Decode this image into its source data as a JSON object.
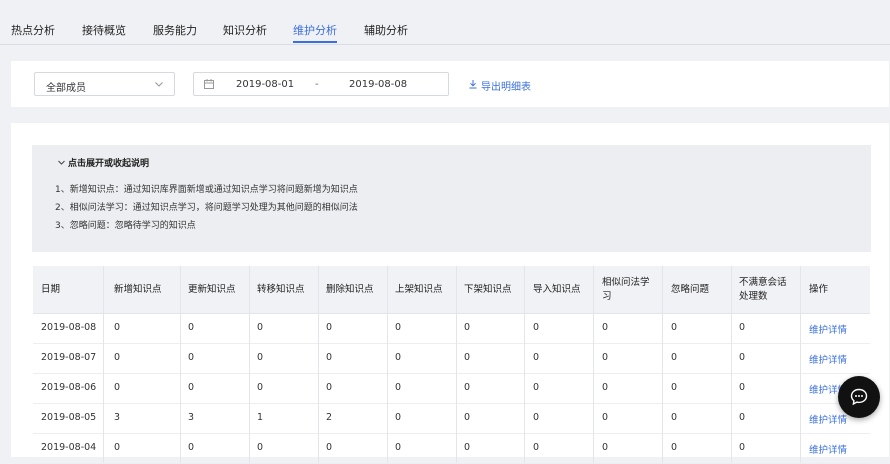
{
  "tabs": [
    {
      "label": "热点分析",
      "active": false
    },
    {
      "label": "接待概览",
      "active": false
    },
    {
      "label": "服务能力",
      "active": false
    },
    {
      "label": "知识分析",
      "active": false
    },
    {
      "label": "维护分析",
      "active": true
    },
    {
      "label": "辅助分析",
      "active": false
    }
  ],
  "filters": {
    "member_select": "全部成员",
    "date_start": "2019-08-01",
    "date_separator": "-",
    "date_end": "2019-08-08",
    "export_label": "导出明细表"
  },
  "explanation": {
    "toggle_label": "点击展开或收起说明",
    "lines": [
      "1、新增知识点：通过知识库界面新增或通过知识点学习将问题新增为知识点",
      "2、相似问法学习：通过知识点学习，将问题学习处理为其他问题的相似问法",
      "3、忽略问题：忽略待学习的知识点"
    ]
  },
  "table": {
    "headers": [
      "日期",
      "新增知识点",
      "更新知识点",
      "转移知识点",
      "删除知识点",
      "上架知识点",
      "下架知识点",
      "导入知识点",
      "相似问法学习",
      "忽略问题",
      "不满意会话处理数",
      "操作"
    ],
    "header_lines": [
      [
        "日期"
      ],
      [
        "新增知识点"
      ],
      [
        "更新知识点"
      ],
      [
        "转移知识点"
      ],
      [
        "删除知识点"
      ],
      [
        "上架知识点"
      ],
      [
        "下架知识点"
      ],
      [
        "导入知识点"
      ],
      [
        "相似问法学",
        "习"
      ],
      [
        "忽略问题"
      ],
      [
        "不满意会话",
        "处理数"
      ],
      [
        "操作"
      ]
    ],
    "rows": [
      {
        "date": "2019-08-08",
        "values": [
          "0",
          "0",
          "0",
          "0",
          "0",
          "0",
          "0",
          "0",
          "0",
          "0"
        ],
        "action": "维护详情"
      },
      {
        "date": "2019-08-07",
        "values": [
          "0",
          "0",
          "0",
          "0",
          "0",
          "0",
          "0",
          "0",
          "0",
          "0"
        ],
        "action": "维护详情"
      },
      {
        "date": "2019-08-06",
        "values": [
          "0",
          "0",
          "0",
          "0",
          "0",
          "0",
          "0",
          "0",
          "0",
          "0"
        ],
        "action": "维护详情"
      },
      {
        "date": "2019-08-05",
        "values": [
          "3",
          "3",
          "1",
          "2",
          "0",
          "0",
          "0",
          "0",
          "0",
          "0"
        ],
        "action": "维护详情"
      },
      {
        "date": "2019-08-04",
        "values": [
          "0",
          "0",
          "0",
          "0",
          "0",
          "0",
          "0",
          "0",
          "0",
          "0"
        ],
        "action": "维护详情"
      }
    ]
  },
  "icons": {
    "select_chevron": "chevron-down-icon",
    "calendar": "calendar-icon",
    "export": "download-icon",
    "explain_toggle": "chevron-down-icon",
    "fab": "chat-icon"
  },
  "colors": {
    "accent": "#3b6fe0",
    "fab": "#111111"
  }
}
